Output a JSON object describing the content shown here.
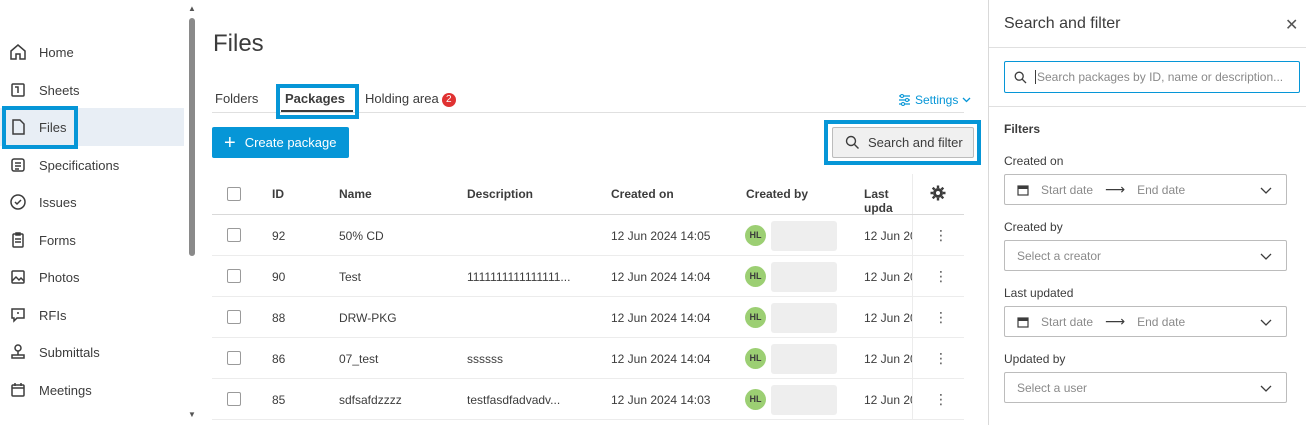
{
  "sidebar": {
    "items": [
      {
        "label": "Home",
        "icon": "home-icon"
      },
      {
        "label": "Sheets",
        "icon": "sheets-icon"
      },
      {
        "label": "Files",
        "icon": "files-icon",
        "active": true
      },
      {
        "label": "Specifications",
        "icon": "specifications-icon"
      },
      {
        "label": "Issues",
        "icon": "issues-icon"
      },
      {
        "label": "Forms",
        "icon": "forms-icon"
      },
      {
        "label": "Photos",
        "icon": "photos-icon"
      },
      {
        "label": "RFIs",
        "icon": "rfis-icon"
      },
      {
        "label": "Submittals",
        "icon": "submittals-icon"
      },
      {
        "label": "Meetings",
        "icon": "meetings-icon"
      }
    ]
  },
  "main": {
    "title": "Files",
    "tabs": [
      {
        "label": "Folders"
      },
      {
        "label": "Packages",
        "active": true
      },
      {
        "label": "Holding area",
        "badge": "2"
      }
    ],
    "settings_label": "Settings",
    "create_label": "Create package",
    "search_filter_label": "Search and filter",
    "columns": [
      "ID",
      "Name",
      "Description",
      "Created on",
      "Created by",
      "Last upda"
    ],
    "rows": [
      {
        "id": "92",
        "name": "50% CD",
        "description": "",
        "created_on": "12 Jun 2024 14:05",
        "initials": "HL",
        "last_updated": "12 Jun 20"
      },
      {
        "id": "90",
        "name": "Test",
        "description": "1111111111111111...",
        "created_on": "12 Jun 2024 14:04",
        "initials": "HL",
        "last_updated": "12 Jun 20"
      },
      {
        "id": "88",
        "name": "DRW-PKG",
        "description": "",
        "created_on": "12 Jun 2024 14:04",
        "initials": "HL",
        "last_updated": "12 Jun 20"
      },
      {
        "id": "86",
        "name": "07_test",
        "description": "ssssss",
        "created_on": "12 Jun 2024 14:04",
        "initials": "HL",
        "last_updated": "12 Jun 20"
      },
      {
        "id": "85",
        "name": "sdfsafdzzzz",
        "description": "testfasdfadvadv...",
        "created_on": "12 Jun 2024 14:03",
        "initials": "HL",
        "last_updated": "12 Jun 20"
      }
    ]
  },
  "panel": {
    "title": "Search and filter",
    "search_placeholder": "Search packages by ID, name or description...",
    "filters_heading": "Filters",
    "created_on_label": "Created on",
    "start_date": "Start date",
    "end_date": "End date",
    "created_by_label": "Created by",
    "created_by_placeholder": "Select a creator",
    "last_updated_label": "Last updated",
    "updated_by_label": "Updated by",
    "updated_by_placeholder": "Select a user"
  },
  "colors": {
    "accent": "#0696d7",
    "badge": "#e03232",
    "avatar": "#9ccf73"
  }
}
